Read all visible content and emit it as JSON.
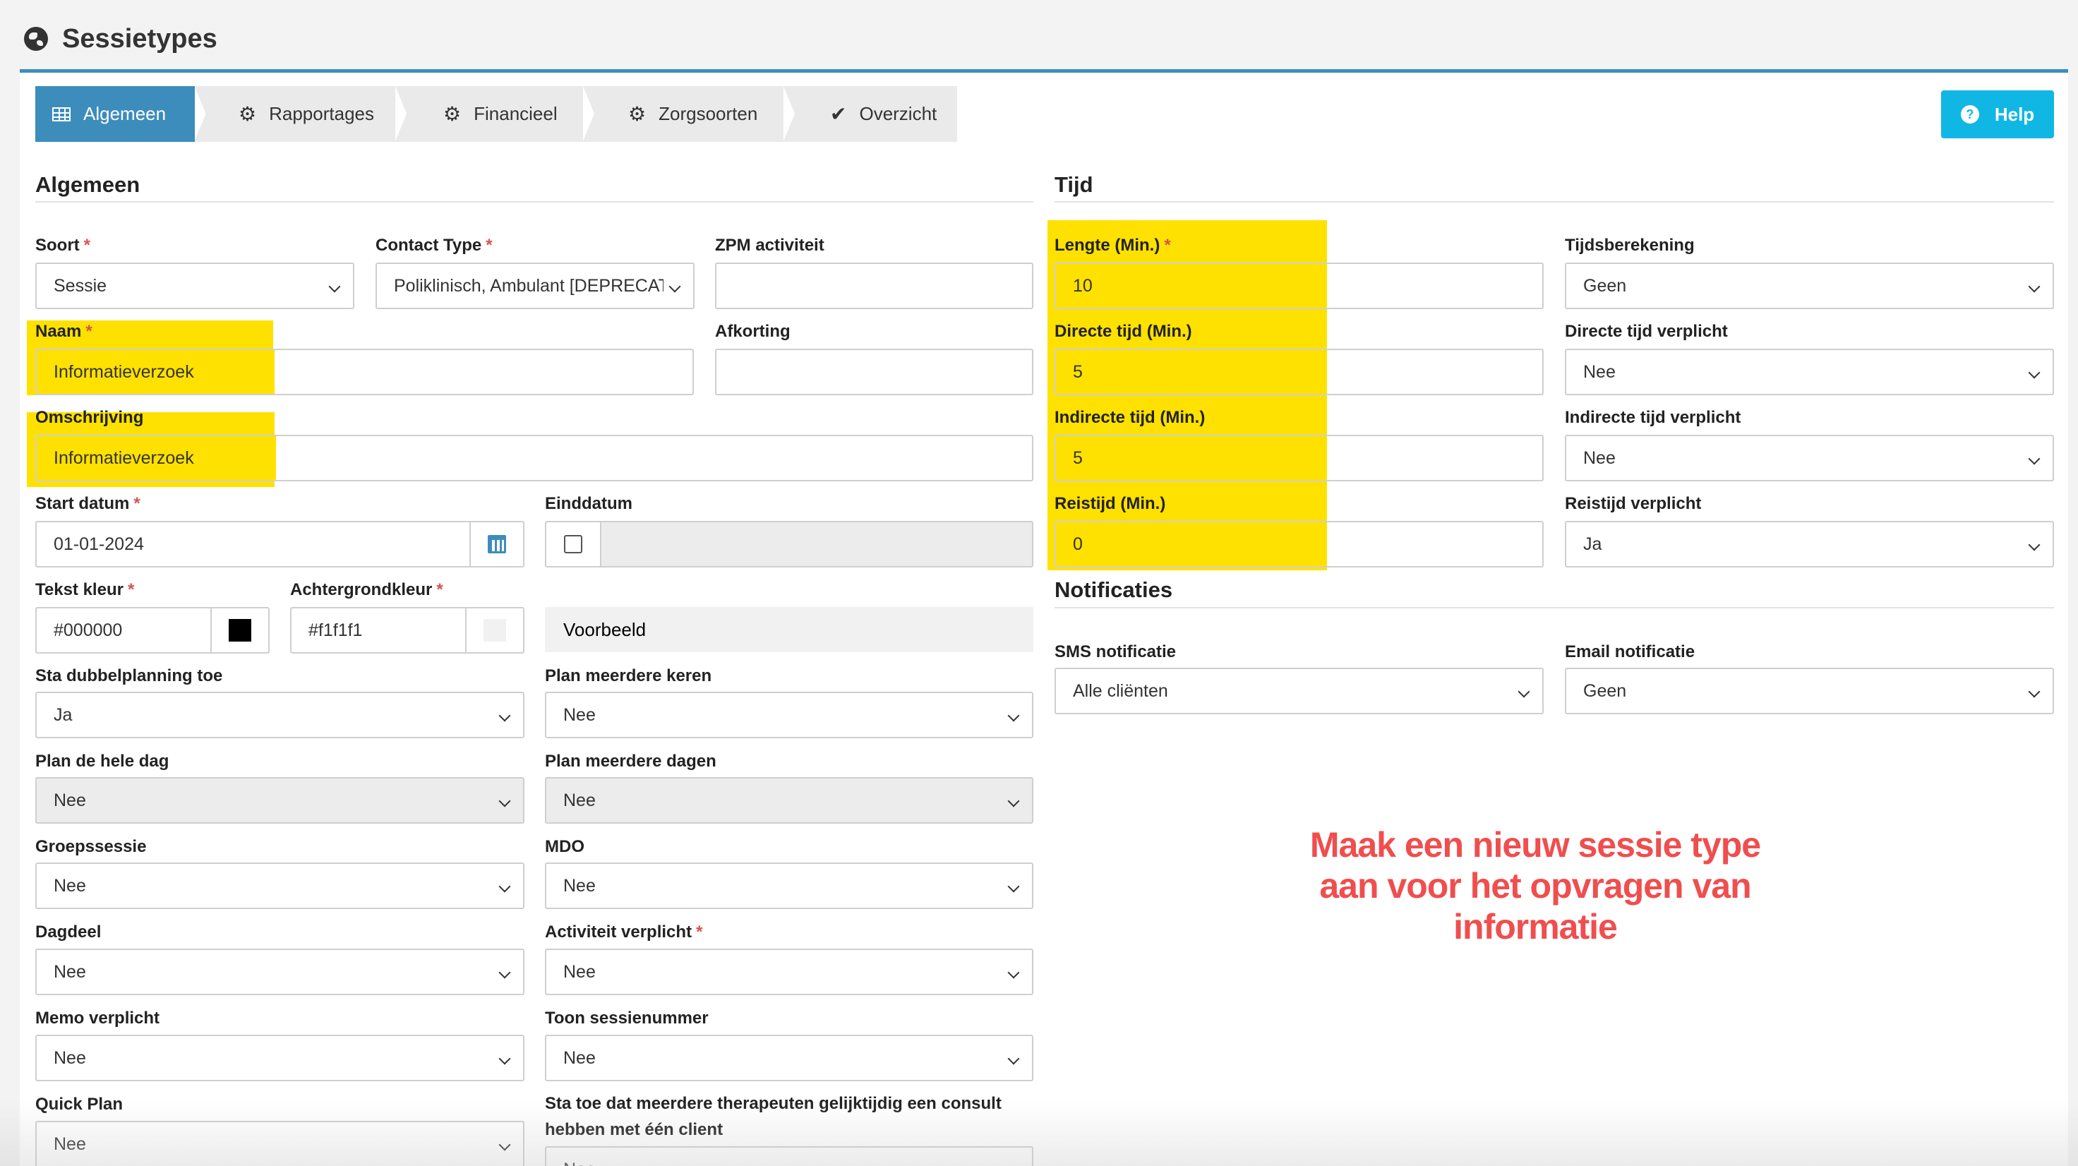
{
  "page": {
    "title": "Sessietypes"
  },
  "wizard": {
    "steps": [
      {
        "label": "Algemeen",
        "icon": "table-icon",
        "active": true
      },
      {
        "label": "Rapportages",
        "icon": "gear-icon"
      },
      {
        "label": "Financieel",
        "icon": "gear-icon"
      },
      {
        "label": "Zorgsoorten",
        "icon": "gear-icon"
      },
      {
        "label": "Overzicht",
        "icon": "check-icon"
      }
    ]
  },
  "help": {
    "label": "Help",
    "icon_glyph": "?"
  },
  "colors": {
    "accent": "#3c8dbc",
    "help": "#11b7e4",
    "highlight": "#ffe100",
    "annotation": "#f04e4e",
    "required": "#d9534f"
  },
  "general": {
    "title": "Algemeen",
    "soort": {
      "label": "Soort",
      "value": "Sessie"
    },
    "contact_type": {
      "label": "Contact Type",
      "value": "Poliklinisch, Ambulant [DEPRECATED]"
    },
    "zpm": {
      "label": "ZPM activiteit",
      "value": ""
    },
    "naam": {
      "label": "Naam",
      "value": "Informatieverzoek"
    },
    "afkorting": {
      "label": "Afkorting",
      "value": ""
    },
    "omschrijving": {
      "label": "Omschrijving",
      "value": "Informatieverzoek"
    },
    "start_datum": {
      "label": "Start datum",
      "value": "01-01-2024"
    },
    "einddatum": {
      "label": "Einddatum",
      "value": ""
    },
    "tekst_kleur": {
      "label": "Tekst kleur",
      "value": "#000000"
    },
    "achtergrondkleur": {
      "label": "Achtergrondkleur",
      "value": "#f1f1f1"
    },
    "voorbeeld": "Voorbeeld",
    "dubbelplanning": {
      "label": "Sta dubbelplanning toe",
      "value": "Ja"
    },
    "meerdere_keren": {
      "label": "Plan meerdere keren",
      "value": "Nee"
    },
    "hele_dag": {
      "label": "Plan de hele dag",
      "value": "Nee"
    },
    "meerdere_dagen": {
      "label": "Plan meerdere dagen",
      "value": "Nee"
    },
    "groepssessie": {
      "label": "Groepssessie",
      "value": "Nee"
    },
    "mdo": {
      "label": "MDO",
      "value": "Nee"
    },
    "dagdeel": {
      "label": "Dagdeel",
      "value": "Nee"
    },
    "activiteit_verplicht": {
      "label": "Activiteit verplicht",
      "value": "Nee"
    },
    "memo_verplicht": {
      "label": "Memo verplicht",
      "value": "Nee"
    },
    "toon_sessienummer": {
      "label": "Toon sessienummer",
      "value": "Nee"
    },
    "quick_plan": {
      "label": "Quick Plan",
      "value": "Nee"
    },
    "gelijktijdig": {
      "label_line1": "Sta toe dat meerdere therapeuten gelijktijdig een consult",
      "label_line2": "hebben met één client",
      "value": "Nee"
    }
  },
  "tijd": {
    "title": "Tijd",
    "lengte": {
      "label": "Lengte (Min.)",
      "value": "10"
    },
    "tijdsberekening": {
      "label": "Tijdsberekening",
      "value": "Geen"
    },
    "directe_tijd": {
      "label": "Directe tijd (Min.)",
      "value": "5"
    },
    "directe_verplicht": {
      "label": "Directe tijd verplicht",
      "value": "Nee"
    },
    "indirecte_tijd": {
      "label": "Indirecte tijd (Min.)",
      "value": "5"
    },
    "indirecte_verplicht": {
      "label": "Indirecte tijd verplicht",
      "value": "Nee"
    },
    "reistijd": {
      "label": "Reistijd (Min.)",
      "value": "0"
    },
    "reistijd_verplicht": {
      "label": "Reistijd verplicht",
      "value": "Ja"
    }
  },
  "notificaties": {
    "title": "Notificaties",
    "sms": {
      "label": "SMS notificatie",
      "value": "Alle cliënten"
    },
    "email": {
      "label": "Email notificatie",
      "value": "Geen"
    }
  },
  "annotation": {
    "line1": "Maak een nieuw sessie type",
    "line2": "aan voor het opvragen van",
    "line3": "informatie"
  }
}
